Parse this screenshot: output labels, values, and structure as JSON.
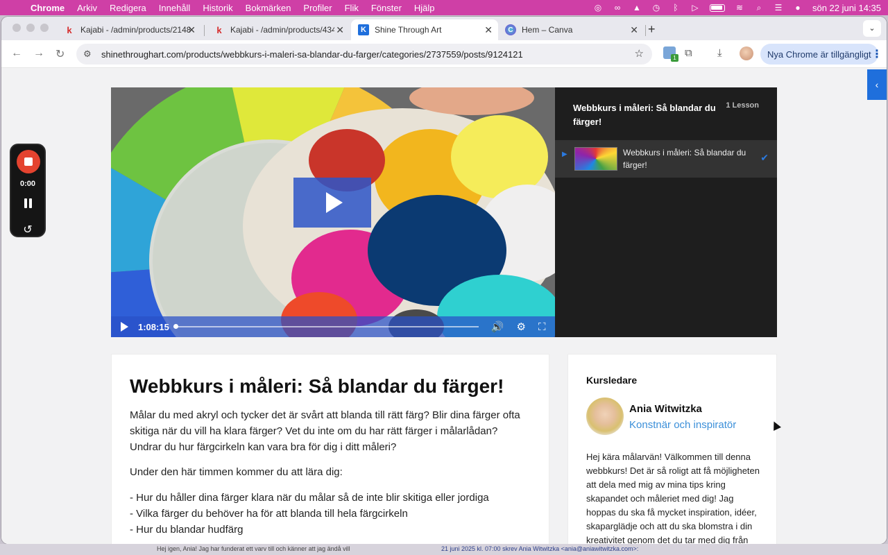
{
  "menubar": {
    "app": "Chrome",
    "items": [
      "Arkiv",
      "Redigera",
      "Innehåll",
      "Historik",
      "Bokmärken",
      "Profiler",
      "Flik",
      "Fönster",
      "Hjälp"
    ],
    "clock": "sön 22 juni  14:35"
  },
  "tabs": [
    {
      "title": "Kajabi - /admin/products/2148",
      "icon": "kajabi-icon",
      "active": false
    },
    {
      "title": "Kajabi - /admin/products/434",
      "icon": "kajabi-icon",
      "active": false
    },
    {
      "title": "Shine Through Art",
      "icon": "site-icon",
      "active": true
    },
    {
      "title": "Hem – Canva",
      "icon": "canva-icon",
      "active": false
    }
  ],
  "toolbar": {
    "url": "shinethroughart.com/products/webbkurs-i-maleri-sa-blandar-du-farger/categories/2737559/posts/9124121",
    "extension_badge": "1",
    "update_label": "Nya Chrome är tillgängligt"
  },
  "player": {
    "time": "1:08:15",
    "progress": 0.0
  },
  "playlist": {
    "title": "Webbkurs i måleri: Så blandar du färger!",
    "count": "1 Lesson",
    "items": [
      {
        "label": "Webbkurs i måleri: Så blandar du färger!",
        "completed": true
      }
    ]
  },
  "article": {
    "title": "Webbkurs i måleri: Så blandar du färger!",
    "intro": "Målar du med akryl och tycker det är svårt att blanda till rätt färg? Blir dina färger ofta skitiga när du vill ha klara färger? Vet du inte om du har rätt färger i målarlådan? Undrar du hur färgcirkeln kan vara bra för dig i ditt måleri?",
    "lead": "Under den här timmen kommer du att lära dig:",
    "bullets": [
      "- Hur du håller dina färger klara när du målar så de inte blir skitiga eller jordiga",
      "- Vilka färger du behöver ha för att blanda till hela färgcirkeln",
      "- Hur du blandar hudfärg"
    ]
  },
  "instructor": {
    "heading": "Kursledare",
    "name": "Ania Witwitzka",
    "role": "Konstnär och inspiratör",
    "bio": "Hej kära målarvän! Välkommen till denna webbkurs! Det är så roligt att få möjligheten att dela med mig av mina tips kring skapandet och måleriet med dig! Jag hoppas du ska få mycket inspiration, idéer, skaparglädje och att du ska blomstra i din kreativitet genom det du tar med dig från"
  },
  "recorder": {
    "time": "0:00"
  },
  "background_window": {
    "left_text": "Hej igen, Ania! Jag har funderat ett varv till och känner att jag ändå vill",
    "right_text": "21 juni 2025 kl. 07:00 skrev Ania Witwitzka <ania@aniawitwitzka.com>:"
  },
  "colors": {
    "menubar": "#cf3fa6",
    "accent": "#1f6fdc",
    "link": "#3b8fd9",
    "playlist_bg": "#1e1e1e"
  }
}
